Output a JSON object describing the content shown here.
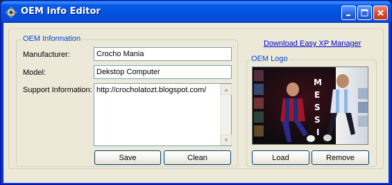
{
  "window": {
    "title": "OEM Info Editor",
    "colors": {
      "title_bar": "#0a5ef5",
      "client": "#ece9d8",
      "group_title": "#0046d5",
      "link": "#0000cc"
    },
    "controls": {
      "minimize": "minimize-icon",
      "maximize": "maximize-icon",
      "close": "close-icon"
    }
  },
  "oem_info": {
    "group_title": "OEM Information",
    "manufacturer_label": "Manufacturer:",
    "manufacturer_value": "Crocho Mania",
    "model_label": "Model:",
    "model_value": "Dekstop Computer",
    "support_label": "Support Information:",
    "support_value": "http://crocholatozt.blogspot.com/",
    "save_label": "Save",
    "clean_label": "Clean"
  },
  "download_link": "Download Easy XP Manager",
  "oem_logo": {
    "group_title": "OEM Logo",
    "logo_text": "MESSI",
    "load_label": "Load",
    "remove_label": "Remove"
  }
}
